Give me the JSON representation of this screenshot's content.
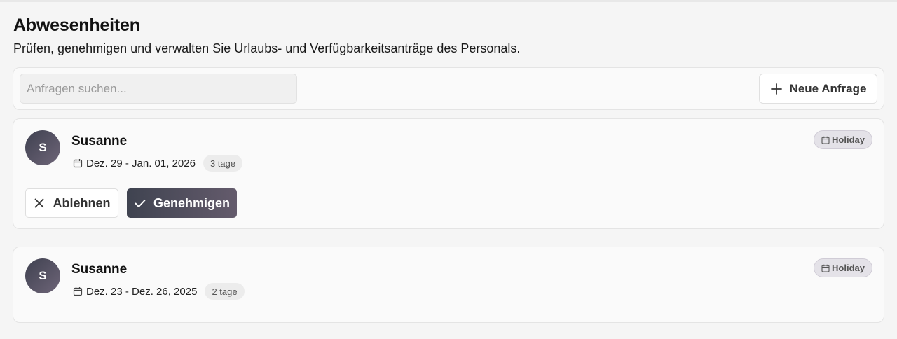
{
  "header": {
    "title": "Abwesenheiten",
    "subtitle": "Prüfen, genehmigen und verwalten Sie Urlaubs- und Verfügbarkeitsanträge des Personals."
  },
  "toolbar": {
    "search_placeholder": "Anfragen suchen...",
    "search_value": "",
    "new_request_label": "Neue Anfrage",
    "new_request_icon": "plus-icon"
  },
  "requests": [
    {
      "avatar_initial": "S",
      "name": "Susanne",
      "date_range": "Dez. 29 - Jan. 01, 2026",
      "days": "3 tage",
      "type": "Holiday",
      "type_icon": "calendar-icon",
      "actions": {
        "reject_label": "Ablehnen",
        "approve_label": "Genehmigen"
      }
    },
    {
      "avatar_initial": "S",
      "name": "Susanne",
      "date_range": "Dez. 23 - Dez. 26, 2025",
      "days": "2 tage",
      "type": "Holiday",
      "type_icon": "calendar-icon"
    }
  ],
  "colors": {
    "background": "#f5f5f5",
    "card": "#fafafa",
    "approve_gradient_start": "#3f4350",
    "approve_gradient_end": "#645b6c",
    "avatar_gradient_start": "#3f4150",
    "avatar_gradient_end": "#6e6578"
  }
}
